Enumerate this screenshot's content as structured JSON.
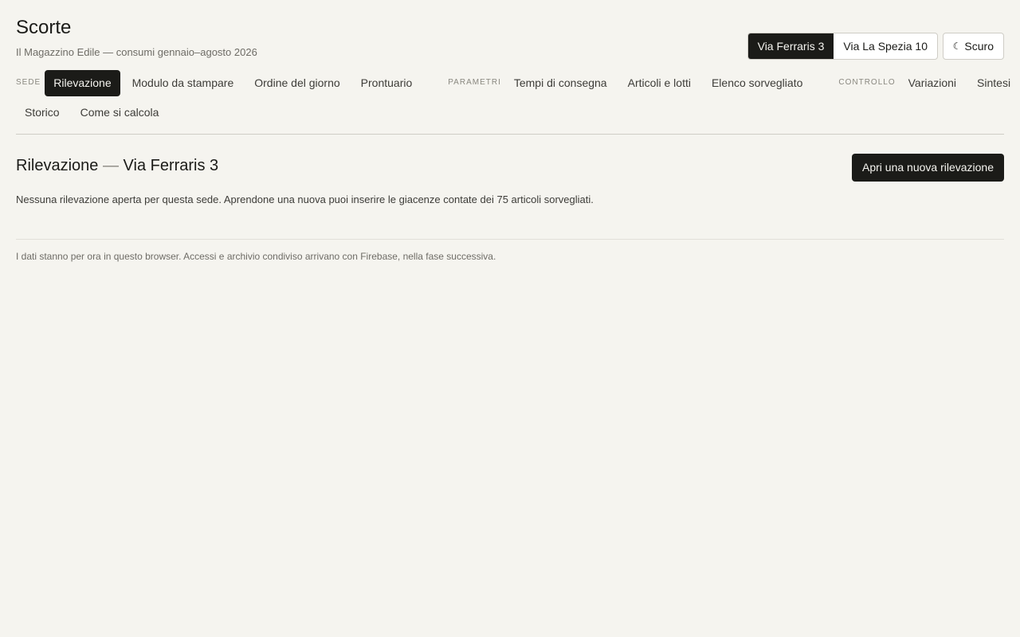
{
  "header": {
    "title": "Scorte",
    "subtitle": "Il Magazzino Edile — consumi gennaio–agosto 2026",
    "sites": [
      "Via Ferraris 3",
      "Via La Spezia 10"
    ],
    "active_site": "Via Ferraris 3",
    "theme_label": "Scuro",
    "theme_icon": "moon-icon"
  },
  "nav": {
    "groups": [
      {
        "label": "SEDE",
        "items": [
          "Rilevazione",
          "Modulo da stampare",
          "Ordine del giorno",
          "Prontuario"
        ]
      },
      {
        "label": "PARAMETRI",
        "items": [
          "Tempi di consegna",
          "Articoli e lotti",
          "Elenco sorvegliato"
        ]
      },
      {
        "label": "CONTROLLO",
        "items": [
          "Variazioni",
          "Sintesi",
          "Storico",
          "Come si calcola"
        ]
      }
    ],
    "active_item": "Rilevazione"
  },
  "main": {
    "title_prefix": "Rilevazione",
    "title_dash": "—",
    "title_site": "Via Ferraris 3",
    "new_button": "Apri una nuova rilevazione",
    "empty_note": "Nessuna rilevazione aperta per questa sede. Aprendone una nuova puoi inserire le giacenze contate dei 75 articoli sorvegliati."
  },
  "footer": {
    "note": "I dati stanno per ora in questo browser. Accessi e archivio condiviso arrivano con Firebase, nella fase successiva."
  },
  "colors": {
    "background": "#f5f4ef",
    "ink": "#1b1b18",
    "muted": "#6e6c66"
  }
}
